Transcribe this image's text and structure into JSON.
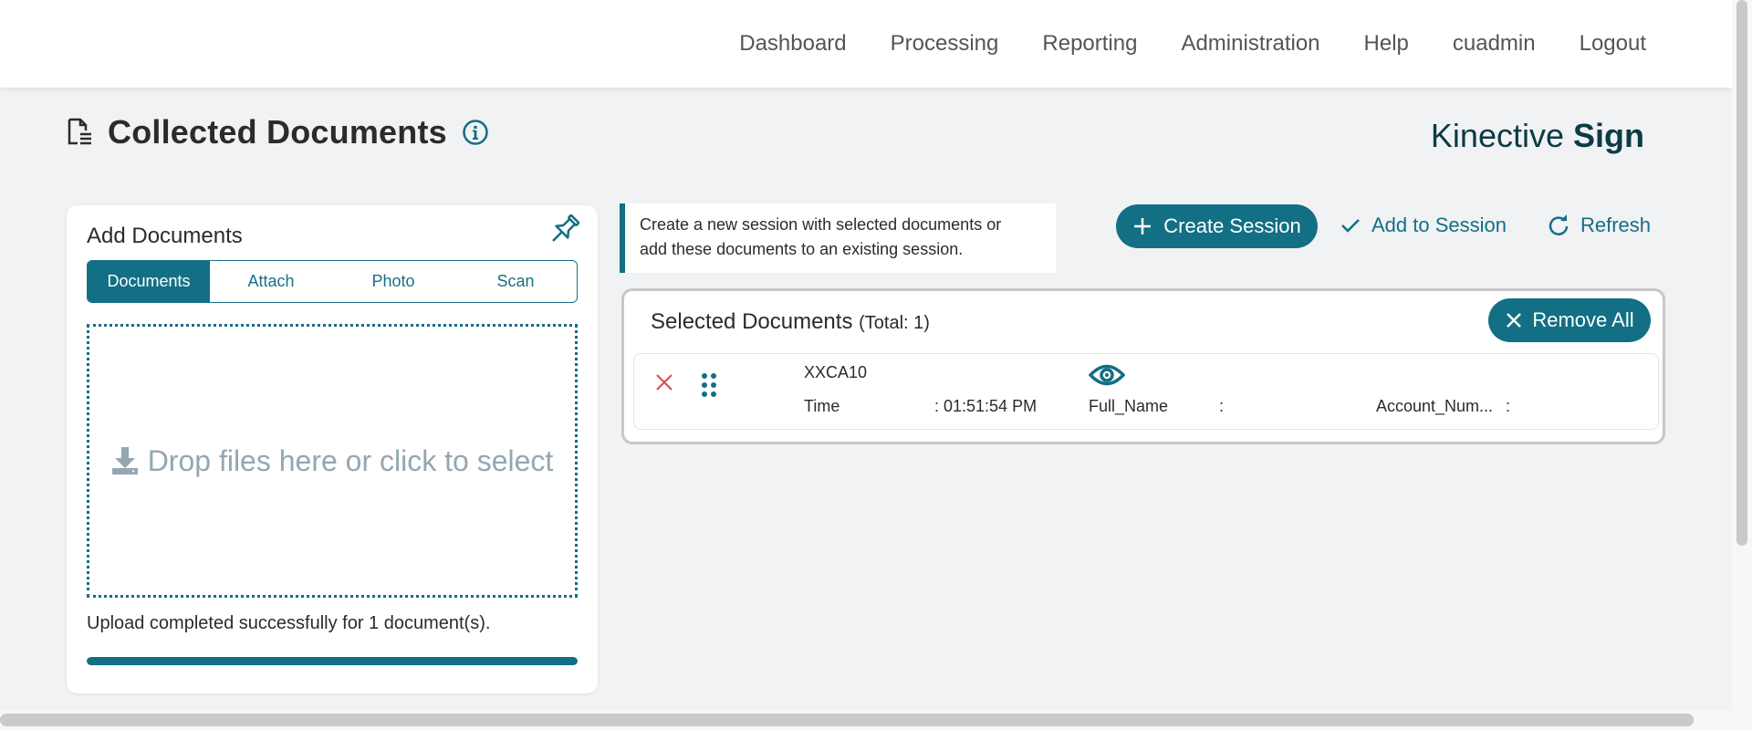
{
  "nav": {
    "items": [
      "Dashboard",
      "Processing",
      "Reporting",
      "Administration",
      "Help",
      "cuadmin",
      "Logout"
    ]
  },
  "page": {
    "title": "Collected Documents",
    "brand_light": "Kinective",
    "brand_bold": "Sign"
  },
  "add_documents": {
    "title": "Add Documents",
    "tabs": [
      "Documents",
      "Attach",
      "Photo",
      "Scan"
    ],
    "active_tab": "Documents",
    "dropzone_text": "Drop files here or click to select",
    "upload_status": "Upload completed successfully for 1 document(s).",
    "progress": 1.0
  },
  "banner": {
    "line1": "Create a new session with selected documents or",
    "line2": "add these documents to an existing session."
  },
  "actions": {
    "create_session": "Create Session",
    "add_to_session": "Add to Session",
    "refresh": "Refresh"
  },
  "selected": {
    "title": "Selected Documents",
    "total": "(Total: 1)",
    "remove_all": "Remove All",
    "rows": [
      {
        "name": "XXCA10",
        "time_label": "Time",
        "time_value": ": 01:51:54 PM",
        "full_name_label": "Full_Name",
        "full_name_value": ":",
        "account_label": "Account_Num...",
        "account_value": ":"
      }
    ]
  },
  "colors": {
    "accent": "#126f84",
    "brand": "#0d3b45",
    "danger": "#d9534f"
  }
}
